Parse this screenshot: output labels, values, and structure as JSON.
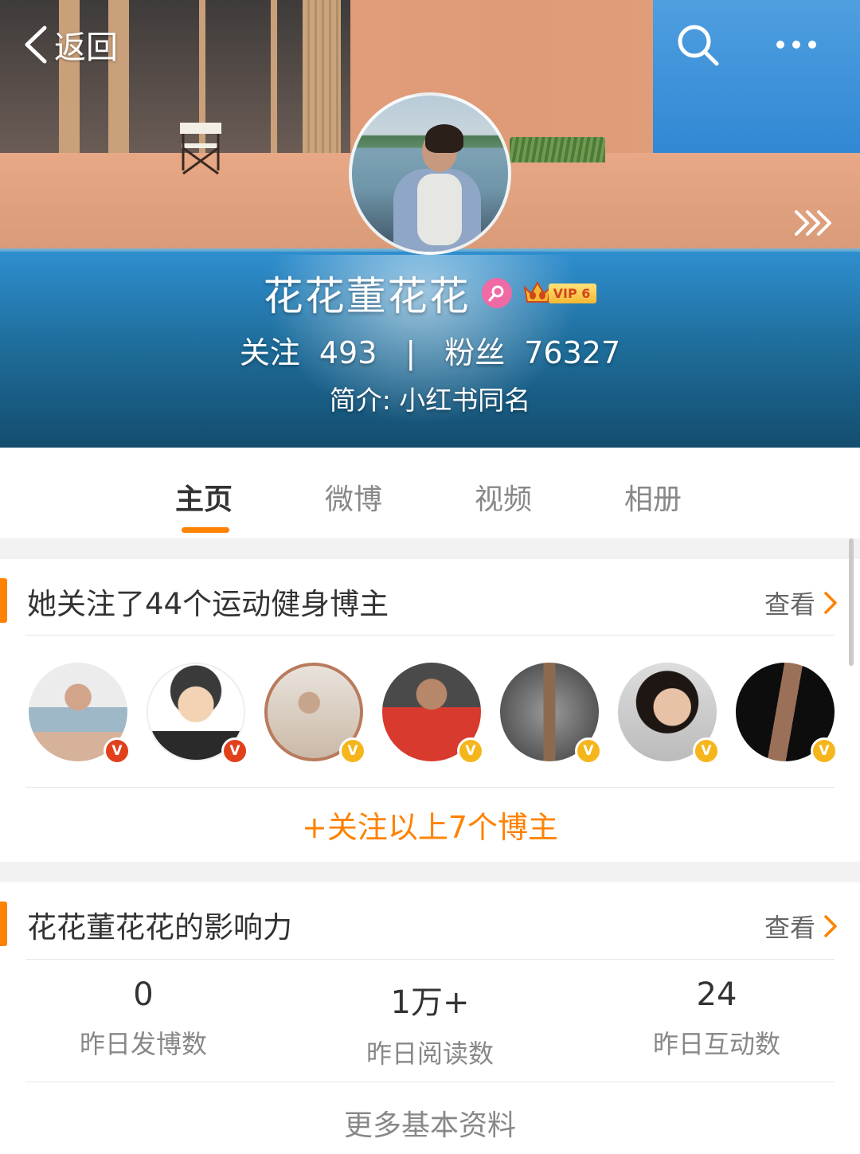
{
  "nav": {
    "back_label": "返回"
  },
  "profile": {
    "name": "花花董花花",
    "vip_label": "VIP 6",
    "following_label": "关注",
    "following_count": "493",
    "separator": "|",
    "followers_label": "粉丝",
    "followers_count": "76327",
    "bio": "简介: 小红书同名"
  },
  "tabs": [
    {
      "label": "主页"
    },
    {
      "label": "微博"
    },
    {
      "label": "视频"
    },
    {
      "label": "相册"
    }
  ],
  "recommend": {
    "title": "她关注了44个运动健身博主",
    "view_label": "查看",
    "verify_mark": "V",
    "bloggers": [
      {
        "verify": "red"
      },
      {
        "verify": "red"
      },
      {
        "verify": "gold"
      },
      {
        "verify": "gold"
      },
      {
        "verify": "gold"
      },
      {
        "verify": "gold"
      },
      {
        "verify": "gold"
      }
    ],
    "follow_all_label": "+关注以上7个博主"
  },
  "influence": {
    "title": "花花董花花的影响力",
    "view_label": "查看",
    "stats": [
      {
        "value": "0",
        "label": "昨日发博数"
      },
      {
        "value": "1万+",
        "label": "昨日阅读数"
      },
      {
        "value": "24",
        "label": "昨日互动数"
      }
    ],
    "more_label": "更多基本资料"
  },
  "colors": {
    "accent": "#ff8200",
    "verify_red": "#e2401a",
    "verify_gold": "#f5b61c",
    "gender_pink": "#f06aa5"
  }
}
